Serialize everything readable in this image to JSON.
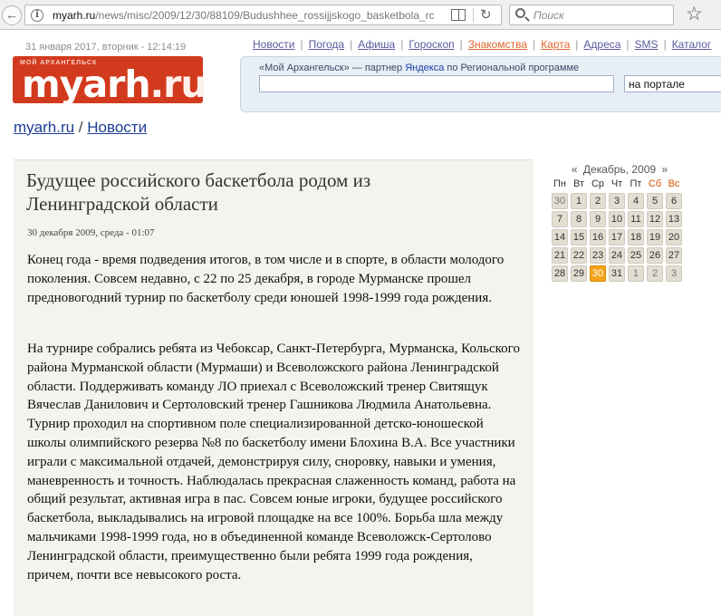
{
  "browser": {
    "url_host": "myarh.ru",
    "url_path": "/news/misc/2009/12/30/88109/Budushhee_rossijjskogo_basketbola_rc",
    "search_placeholder": "Поиск"
  },
  "header": {
    "datetime": "31 января 2017, вторник - 12:14:19",
    "logo_tagline": "МОЙ АРХАНГЕЛЬСК",
    "logo_main": "myarh",
    "logo_ru": ".ru",
    "nav": [
      {
        "label": "Новости",
        "accent": false
      },
      {
        "label": "Погода",
        "accent": false
      },
      {
        "label": "Афиша",
        "accent": false
      },
      {
        "label": "Гороскоп",
        "accent": false
      },
      {
        "label": "Знакомства",
        "accent": true
      },
      {
        "label": "Карта",
        "accent": true
      },
      {
        "label": "Адреса",
        "accent": false
      },
      {
        "label": "SMS",
        "accent": false
      },
      {
        "label": "Каталог",
        "accent": false
      }
    ],
    "accent_color": "#e0662d",
    "logo_color": "#d23a1e"
  },
  "yandex": {
    "note_prefix": "«Мой Архангельск» — партнер ",
    "note_link": "Яндекса",
    "note_suffix": " по Региональной программе",
    "search_value": "",
    "scope": "на портале"
  },
  "breadcrumb": {
    "home": "myarh.ru",
    "sep": " / ",
    "section": "Новости"
  },
  "article": {
    "title": "Будущее российского баскетбола родом из Ленинградской области",
    "date": "30 декабря 2009, среда - 01:07",
    "p1": "Конец года - время подведения итогов, в том числе и в спорте, в области молодого поколения. Совсем недавно, с 22 по 25 декабря, в городе Мурманске прошел предновогодний турнир по баскетболу среди юношей 1998-1999 года рождения.",
    "p2": "На турнире собрались ребята из Чебоксар, Санкт-Петербурга, Мурманска, Кольского района Мурманской области (Мурмаши) и Всеволожского района Ленинградской области. Поддерживать команду ЛО приехал с Всеволожский тренер Свитящук Вячеслав Данилович и Сертоловский тренер Гашникова Людмила Анатольевна. Турнир проходил на спортивном поле специализированной детско-юношеской школы олимпийского резерва №8 по баскетболу имени Блохина В.А. Все участники играли с максимальной отдачей, демонстрируя силу, сноровку, навыки и умения, маневренность и точность. Наблюдалась прекрасная слаженность команд, работа на общий результат, активная игра в пас. Совсем юные игроки, будущее российского баскетбола, выкладывались на игровой площадке на все 100%. Борьба шла между мальчиками 1998-1999 года, но в объединенной команде Всеволожск-Сертолово Ленинградской области, преимущественно были ребята 1999 года рождения, причем, почти все невысокого роста."
  },
  "calendar": {
    "prev": "«",
    "next": "»",
    "month": "Декабрь, 2009",
    "weekdays": [
      "Пн",
      "Вт",
      "Ср",
      "Чт",
      "Пт",
      "Сб",
      "Вс"
    ],
    "days": [
      {
        "d": "30",
        "other": true
      },
      {
        "d": "1"
      },
      {
        "d": "2"
      },
      {
        "d": "3"
      },
      {
        "d": "4"
      },
      {
        "d": "5"
      },
      {
        "d": "6"
      },
      {
        "d": "7"
      },
      {
        "d": "8"
      },
      {
        "d": "9"
      },
      {
        "d": "10"
      },
      {
        "d": "11"
      },
      {
        "d": "12"
      },
      {
        "d": "13"
      },
      {
        "d": "14"
      },
      {
        "d": "15"
      },
      {
        "d": "16"
      },
      {
        "d": "17"
      },
      {
        "d": "18"
      },
      {
        "d": "19"
      },
      {
        "d": "20"
      },
      {
        "d": "21"
      },
      {
        "d": "22"
      },
      {
        "d": "23"
      },
      {
        "d": "24"
      },
      {
        "d": "25"
      },
      {
        "d": "26"
      },
      {
        "d": "27"
      },
      {
        "d": "28"
      },
      {
        "d": "29"
      },
      {
        "d": "30",
        "today": true
      },
      {
        "d": "31"
      },
      {
        "d": "1",
        "other": true
      },
      {
        "d": "2",
        "other": true
      },
      {
        "d": "3",
        "other": true
      }
    ],
    "today_color": "#f3a51b"
  }
}
